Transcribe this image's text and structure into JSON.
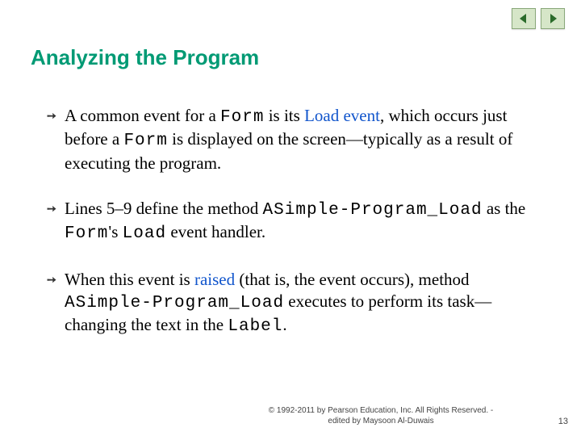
{
  "nav": {
    "prev_icon": "triangle-left",
    "next_icon": "triangle-right"
  },
  "title": "Analyzing the Program",
  "bullets": [
    {
      "pre1": "A common event for a ",
      "code1": "Form",
      "mid1": " is its ",
      "link": "Load event",
      "mid2": ", which occurs just before a ",
      "code2": "Form",
      "post": " is displayed on the screen—typically as a result of executing the program."
    },
    {
      "pre1": "Lines 5–9 define the method ",
      "code1": "ASimple-Program_Load",
      "mid1": " as the ",
      "code2": "Form",
      "mid2": "'s ",
      "code3": "Load",
      "post": " event handler."
    },
    {
      "pre1": "When this event is ",
      "link": "raised",
      "mid1": " (that is, the event occurs), method ",
      "code1": "ASimple-Program_Load",
      "mid2": " executes to perform its task—changing the text in the ",
      "code2": "Label",
      "post": "."
    }
  ],
  "footer": {
    "line1": "© 1992-2011 by Pearson Education, Inc. All Rights Reserved. -",
    "line2": "edited by Maysoon Al-Duwais"
  },
  "page_number": "13"
}
